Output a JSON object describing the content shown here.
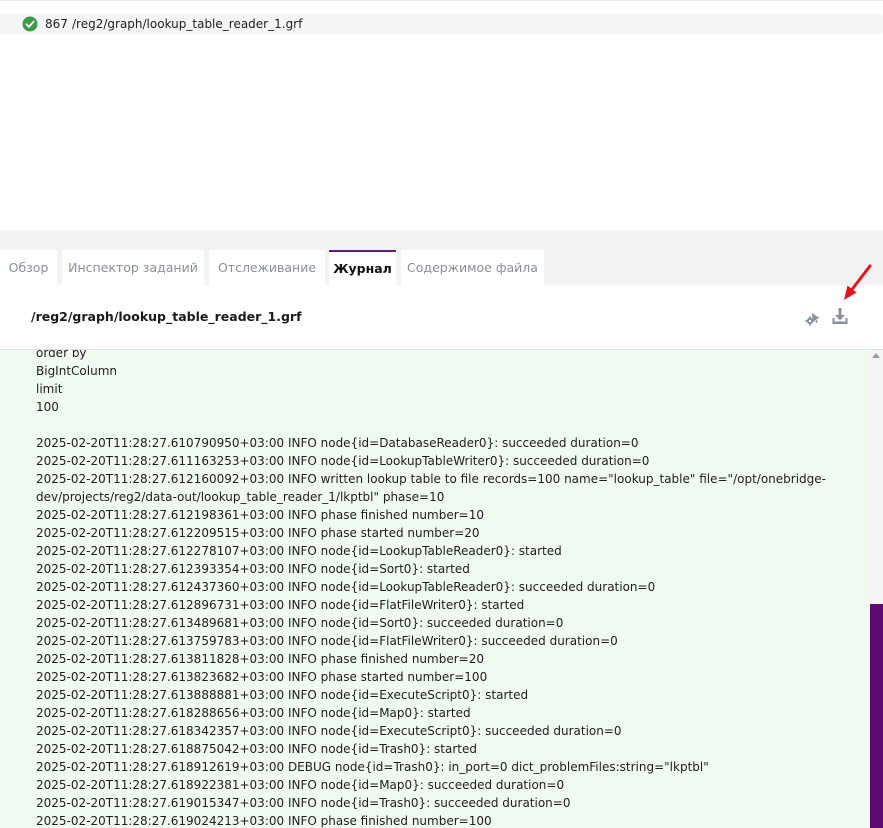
{
  "job": {
    "id": "867",
    "path": "/reg2/graph/lookup_table_reader_1.grf",
    "status_icon": "check-circle-icon",
    "status_color": "#3c9a4a"
  },
  "tabs": [
    {
      "label": "Обзор",
      "active": false
    },
    {
      "label": "Инспектор заданий",
      "active": false
    },
    {
      "label": "Отслеживание",
      "active": false
    },
    {
      "label": "Журнал",
      "active": true
    },
    {
      "label": "Содержимое файла",
      "active": false
    }
  ],
  "header": {
    "title": "/reg2/graph/lookup_table_reader_1.grf",
    "settings_icon": "gear-pointer-icon",
    "download_icon": "download-icon"
  },
  "colors": {
    "accent": "#5e0a73",
    "log_background": "#f1faf1",
    "annotation_arrow": "#e8141b"
  },
  "log": {
    "lines": [
      "order by",
      "BigIntColumn",
      "limit",
      "100",
      "",
      "2025-02-20T11:28:27.610790950+03:00 INFO node{id=DatabaseReader0}: succeeded duration=0",
      "2025-02-20T11:28:27.611163253+03:00 INFO node{id=LookupTableWriter0}: succeeded duration=0",
      "2025-02-20T11:28:27.612160092+03:00 INFO written lookup table to file records=100 name=\"lookup_table\" file=\"/opt/onebridge-",
      "dev/projects/reg2/data-out/lookup_table_reader_1/lkptbl\" phase=10",
      "2025-02-20T11:28:27.612198361+03:00 INFO phase finished number=10",
      "2025-02-20T11:28:27.612209515+03:00 INFO phase started number=20",
      "2025-02-20T11:28:27.612278107+03:00 INFO node{id=LookupTableReader0}: started",
      "2025-02-20T11:28:27.612393354+03:00 INFO node{id=Sort0}: started",
      "2025-02-20T11:28:27.612437360+03:00 INFO node{id=LookupTableReader0}: succeeded duration=0",
      "2025-02-20T11:28:27.612896731+03:00 INFO node{id=FlatFileWriter0}: started",
      "2025-02-20T11:28:27.613489681+03:00 INFO node{id=Sort0}: succeeded duration=0",
      "2025-02-20T11:28:27.613759783+03:00 INFO node{id=FlatFileWriter0}: succeeded duration=0",
      "2025-02-20T11:28:27.613811828+03:00 INFO phase finished number=20",
      "2025-02-20T11:28:27.613823682+03:00 INFO phase started number=100",
      "2025-02-20T11:28:27.613888881+03:00 INFO node{id=ExecuteScript0}: started",
      "2025-02-20T11:28:27.618288656+03:00 INFO node{id=Map0}: started",
      "2025-02-20T11:28:27.618342357+03:00 INFO node{id=ExecuteScript0}: succeeded duration=0",
      "2025-02-20T11:28:27.618875042+03:00 INFO node{id=Trash0}: started",
      "2025-02-20T11:28:27.618912619+03:00 DEBUG node{id=Trash0}: in_port=0 dict_problemFiles:string=\"lkptbl\"",
      "2025-02-20T11:28:27.618922381+03:00 INFO node{id=Map0}: succeeded duration=0",
      "2025-02-20T11:28:27.619015347+03:00 INFO node{id=Trash0}: succeeded duration=0",
      "2025-02-20T11:28:27.619024213+03:00 INFO phase finished number=100"
    ]
  }
}
